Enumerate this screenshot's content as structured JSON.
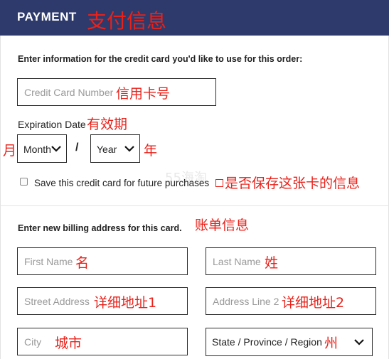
{
  "header": {
    "title": "PAYMENT",
    "annotation": "支付信息",
    "bg_color": "#2d3a6b"
  },
  "annotation_color": "#e8221b",
  "watermark": "55海淘",
  "card": {
    "instructions": "Enter information for the credit card you'd like to use for this order:",
    "number_placeholder": "Credit Card Number",
    "number_annotation": "信用卡号",
    "expiration_label": "Expiration Date",
    "expiration_annotation": "有效期",
    "month_annotation": "月",
    "month_value": "Month",
    "separator": "/",
    "year_value": "Year",
    "year_annotation": "年",
    "save_label": "Save this credit card for future purchases",
    "save_annotation": "是否保存这张卡的信息",
    "save_checked": false
  },
  "billing": {
    "instructions": "Enter new billing address for this card.",
    "annotation": "账单信息",
    "first_name": {
      "placeholder": "First Name",
      "annotation": "名"
    },
    "last_name": {
      "placeholder": "Last Name",
      "annotation": "姓"
    },
    "street": {
      "placeholder": "Street Address",
      "annotation": "详细地址1"
    },
    "address2": {
      "placeholder": "Address Line 2",
      "annotation": "详细地址2"
    },
    "city": {
      "placeholder": "City",
      "annotation": "城市"
    },
    "state": {
      "value": "State / Province / Region",
      "annotation": "州"
    }
  }
}
